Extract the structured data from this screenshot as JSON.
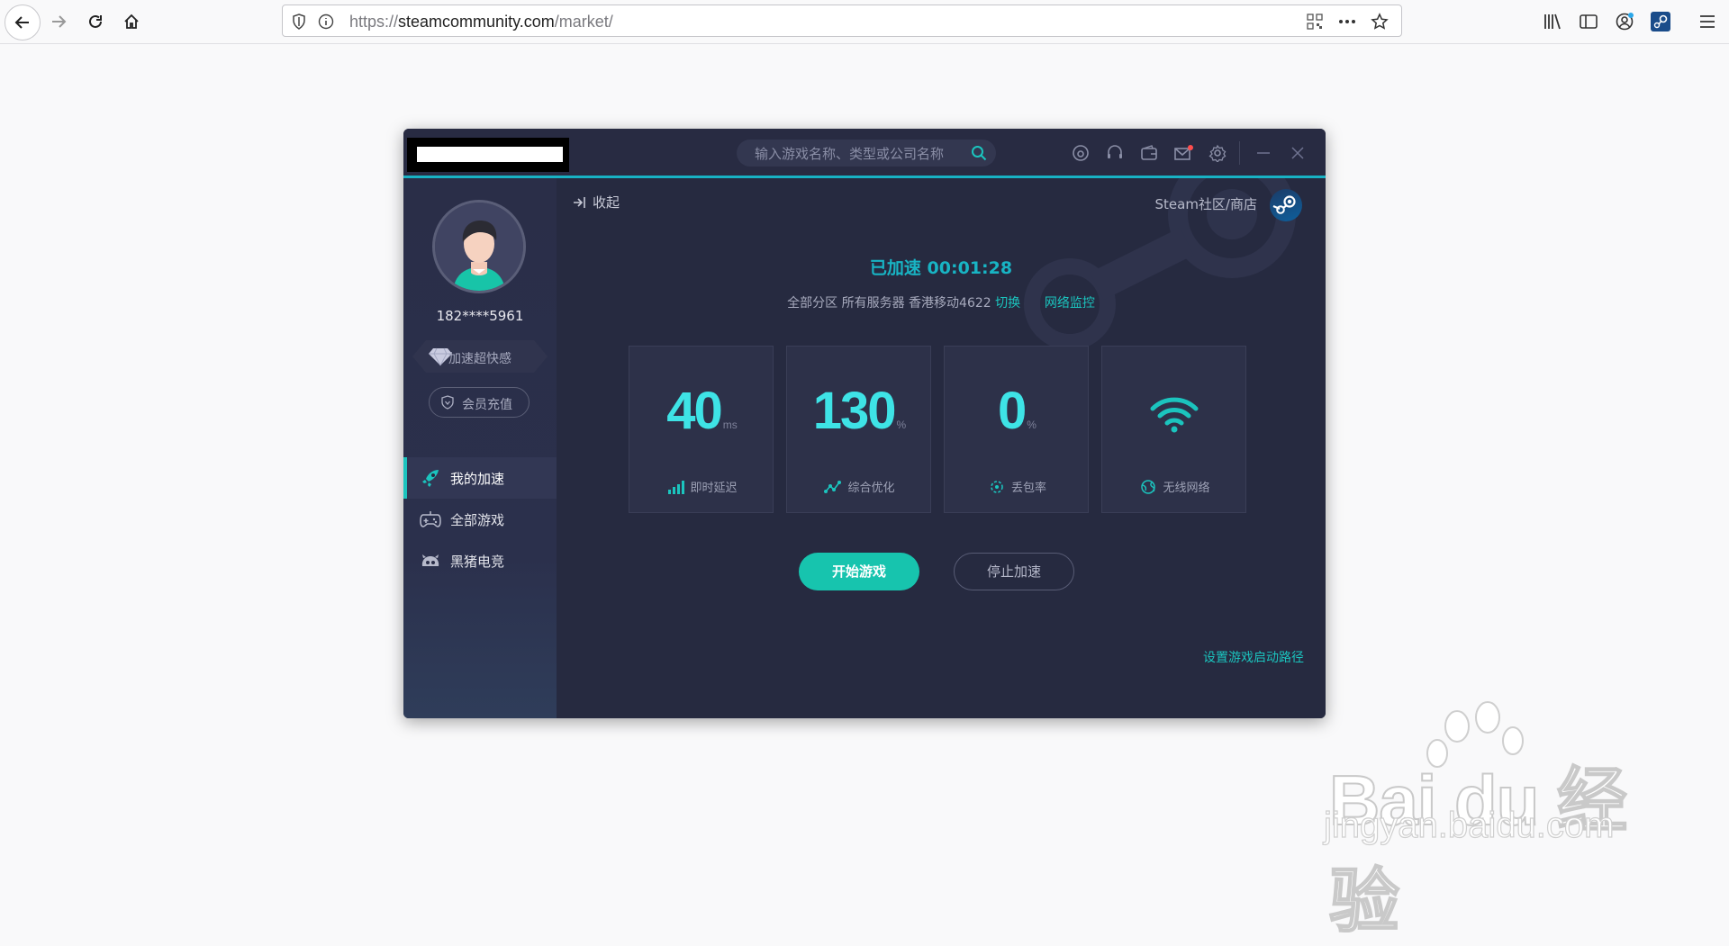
{
  "browser": {
    "url_prefix": "https://",
    "url_host": "steamcommunity.com",
    "url_path": "/market/"
  },
  "app": {
    "search_placeholder": "输入游戏名称、类型或公司名称",
    "user": {
      "username": "182****5961",
      "vip_text": "加速超快感",
      "recharge_label": "会员充值"
    },
    "menu": [
      {
        "label": "我的加速",
        "icon": "rocket-icon",
        "active": true
      },
      {
        "label": "全部游戏",
        "icon": "gamepad-icon",
        "active": false
      },
      {
        "label": "黑猪电竞",
        "icon": "pig-icon",
        "active": false
      }
    ],
    "main": {
      "collapse_label": "收起",
      "steam_link": "Steam社区/商店",
      "status": "已加速 00:01:28",
      "server_info": "全部分区 所有服务器 香港移动4622",
      "switch_label": "切换",
      "monitor_label": "网络监控",
      "stats": [
        {
          "value": "40",
          "unit": "ms",
          "label": "即时延迟",
          "icon": "signal-bars-icon"
        },
        {
          "value": "130",
          "unit": "%",
          "label": "综合优化",
          "icon": "optimize-line-icon"
        },
        {
          "value": "0",
          "unit": "%",
          "label": "丢包率",
          "icon": "packet-loss-icon"
        },
        {
          "value": "",
          "unit": "",
          "label": "无线网络",
          "icon": "wifi-icon"
        }
      ],
      "start_button": "开始游戏",
      "stop_button": "停止加速",
      "set_path_link": "设置游戏启动路径"
    },
    "colors": {
      "accent": "#1bc4be",
      "titlebar_border": "#18b2c4",
      "background": "#262a40"
    }
  },
  "watermark": {
    "brand": "Bai du 经验",
    "site": "jingyan.baidu.com"
  }
}
